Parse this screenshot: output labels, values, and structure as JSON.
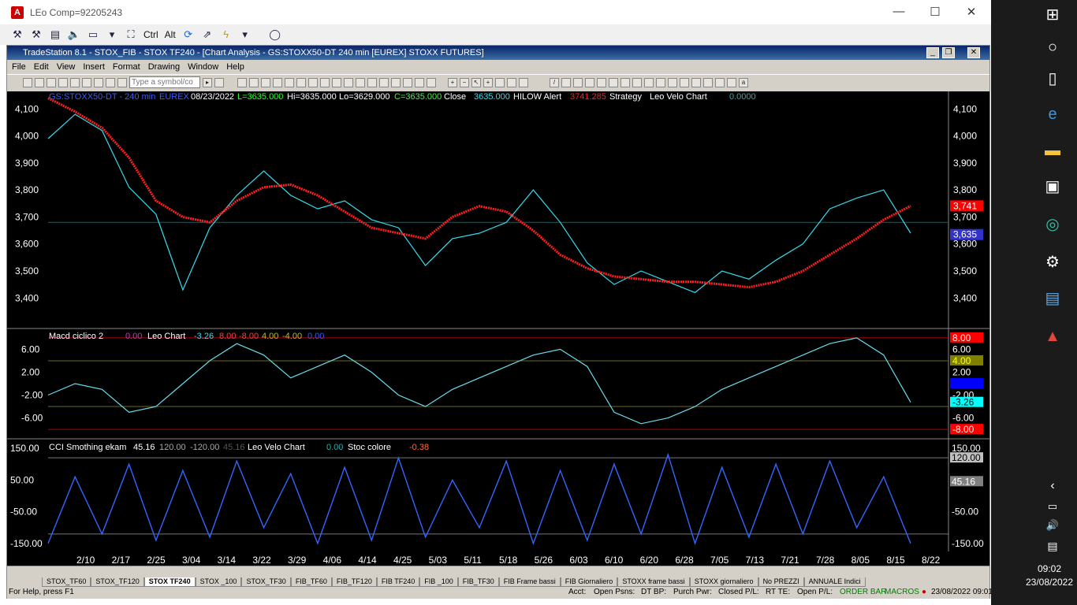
{
  "window": {
    "title": "LEo Comp=92205243",
    "min": "—",
    "max": "☐",
    "close": "✕"
  },
  "toolbar": {
    "ctrl": "Ctrl",
    "alt": "Alt"
  },
  "app": {
    "title": "TradeStation 8.1 - STOX_FIB - STOX TF240 - [Chart Analysis - GS:STOXX50-DT  240 min  [EUREX] STOXX FUTURES]",
    "menu": [
      "File",
      "Edit",
      "View",
      "Insert",
      "Format",
      "Drawing",
      "Window",
      "Help"
    ],
    "symbol_placeholder": "Type a symbol/co"
  },
  "chart_data": {
    "type": "line",
    "header": {
      "symbol": "GS:STOXX50-DT - 240 min",
      "exchange": "EUREX",
      "date": "08/23/2022",
      "last": "L=3635.000",
      "hi": "Hi=3635.000",
      "lo": "Lo=3629.000",
      "close": "C=3635.000",
      "close_label": "Close",
      "close_val": "3635.000",
      "hilow": "HILOW Alert",
      "hilow_val": "3741.285",
      "strategy": "Strategy",
      "leo": "Leo Velo Chart",
      "leo_val": "0.0000"
    },
    "price_ticks": [
      "4,100",
      "4,000",
      "3,900",
      "3,800",
      "3,700",
      "3,600",
      "3,500",
      "3,400"
    ],
    "price_tick_values": [
      4100,
      4000,
      3900,
      3800,
      3700,
      3600,
      3500,
      3400
    ],
    "price_ylim": [
      3290,
      4165
    ],
    "price_right_labels": [
      {
        "text": "3,741",
        "value": 3741,
        "color": "#ff0000"
      },
      {
        "text": "3,635",
        "value": 3635,
        "color": "#3333cc"
      }
    ],
    "x_dates": [
      "2/10",
      "2/17",
      "2/25",
      "3/04",
      "3/14",
      "3/22",
      "3/29",
      "4/06",
      "4/14",
      "4/25",
      "5/03",
      "5/11",
      "5/18",
      "5/26",
      "6/03",
      "6/10",
      "6/20",
      "6/28",
      "7/05",
      "7/13",
      "7/21",
      "7/28",
      "8/05",
      "8/15",
      "8/22"
    ],
    "price_series": [
      {
        "name": "Close",
        "values": [
          3990,
          4080,
          4020,
          3810,
          3710,
          3430,
          3660,
          3780,
          3870,
          3780,
          3730,
          3760,
          3690,
          3660,
          3520,
          3620,
          3640,
          3680,
          3800,
          3680,
          3530,
          3450,
          3500,
          3460,
          3420,
          3500,
          3470,
          3540,
          3600,
          3730,
          3770,
          3800,
          3640
        ]
      },
      {
        "name": "HILOW Alert",
        "values": [
          4140,
          4090,
          4030,
          3920,
          3760,
          3700,
          3680,
          3760,
          3810,
          3820,
          3780,
          3720,
          3660,
          3640,
          3620,
          3700,
          3740,
          3720,
          3650,
          3560,
          3510,
          3480,
          3470,
          3460,
          3460,
          3450,
          3440,
          3460,
          3500,
          3560,
          3620,
          3690,
          3741
        ]
      }
    ],
    "macd": {
      "label": "Macd ciclico 2",
      "v1": "0.00",
      "leo": "Leo Chart",
      "v2": "-3.26",
      "v3": "8.00",
      "v4": "-8.00",
      "v5": "4.00",
      "v6": "-4.00",
      "v7": "0.00",
      "ticks": [
        "6.00",
        "2.00",
        "-2.00",
        "-6.00"
      ],
      "tick_values": [
        6,
        2,
        -2,
        -6
      ],
      "ylim": [
        -9.5,
        9.5
      ],
      "right_labels": [
        {
          "text": "8.00",
          "value": 8,
          "bg": "#ff0000",
          "fg": "#ffffff"
        },
        {
          "text": "6.00",
          "value": 6,
          "bg": "#000000",
          "fg": "#ffffff"
        },
        {
          "text": "4.00",
          "value": 4,
          "bg": "#808000",
          "fg": "#ffff00"
        },
        {
          "text": "2.00",
          "value": 2,
          "bg": "#000000",
          "fg": "#ffffff"
        },
        {
          "text": "0.00",
          "value": 0,
          "bg": "#0000ff",
          "fg": "#0000ff"
        },
        {
          "text": "-2.00",
          "value": -2,
          "bg": "#000000",
          "fg": "#ffffff"
        },
        {
          "text": "-3.26",
          "value": -3.26,
          "bg": "#00ffff",
          "fg": "#000000"
        },
        {
          "text": "-6.00",
          "value": -6,
          "bg": "#000000",
          "fg": "#ffffff"
        },
        {
          "text": "-8.00",
          "value": -8,
          "bg": "#ff0000",
          "fg": "#ffffff"
        }
      ],
      "values": [
        -2,
        0,
        -1,
        -5,
        -4,
        0,
        4,
        7,
        5,
        1,
        3,
        5,
        2,
        -2,
        -4,
        -1,
        1,
        3,
        5,
        6,
        3,
        -5,
        -7,
        -6,
        -4,
        -1,
        1,
        3,
        5,
        7,
        8,
        5,
        -3.26
      ]
    },
    "cci": {
      "label": "CCI Smothing ekam",
      "v1": "45.16",
      "v2": "120.00",
      "v3": "-120.00",
      "v4": "45.16",
      "leo": "Leo Velo Chart",
      "stoc_val0": "0.00",
      "stoc": "Stoc colore",
      "stoc_val": "-0.38",
      "ticks": [
        "150.00",
        "50.00",
        "-50.00",
        "-150.00"
      ],
      "tick_values": [
        150,
        50,
        -50,
        -150
      ],
      "ylim": [
        -175,
        175
      ],
      "right_labels": [
        {
          "text": "150.00",
          "value": 150,
          "bg": "#000000",
          "fg": "#ffffff"
        },
        {
          "text": "120.00",
          "value": 120,
          "bg": "#c0c0c0",
          "fg": "#000000"
        },
        {
          "text": "45.16",
          "value": 45.16,
          "bg": "#808080",
          "fg": "#ffffff"
        },
        {
          "text": "-50.00",
          "value": -50,
          "bg": "#000000",
          "fg": "#ffffff"
        },
        {
          "text": "-150.00",
          "value": -150,
          "bg": "#000000",
          "fg": "#ffffff"
        }
      ],
      "values": [
        -150,
        60,
        -120,
        100,
        -140,
        80,
        -130,
        110,
        -100,
        70,
        -150,
        90,
        -140,
        120,
        -130,
        50,
        -100,
        110,
        -150,
        80,
        -140,
        100,
        -120,
        130,
        -150,
        90,
        -130,
        100,
        -120,
        110,
        -100,
        60,
        -150
      ]
    }
  },
  "tabs": [
    "STOX_TF60",
    "STOX_TF120",
    "STOX TF240",
    "STOX _100",
    "STOX_TF30",
    "FIB_TF60",
    "FIB_TF120",
    "FIB TF240",
    "FIB _100",
    "FIB_TF30",
    "FIB Frame bassi",
    "FIB Giornaliero",
    "STOXX frame bassi",
    "STOXX giornaliero",
    "No PREZZI",
    "ANNUALE Indici"
  ],
  "active_tab": "STOX TF240",
  "status": {
    "help": "For Help, press F1",
    "acct": "Acct:",
    "open_psns": "Open Psns:",
    "dt_bp": "DT BP:",
    "purch_pwr": "Purch Pwr:",
    "closed_pl": "Closed P/L:",
    "rt_te": "RT TE:",
    "open_pl": "Open P/L:",
    "order_bar": "ORDER BAR",
    "macros": "MACROS",
    "datetime": "23/08/2022 09:01"
  },
  "taskbar": {
    "time": "09:02",
    "date": "23/08/2022"
  },
  "icons": [
    "windows-icon",
    "cortana-icon",
    "task-view-icon",
    "edge-icon",
    "file-explorer-icon",
    "store-icon",
    "edge-new-icon",
    "settings-icon",
    "app-icon",
    "tradestation-icon"
  ]
}
